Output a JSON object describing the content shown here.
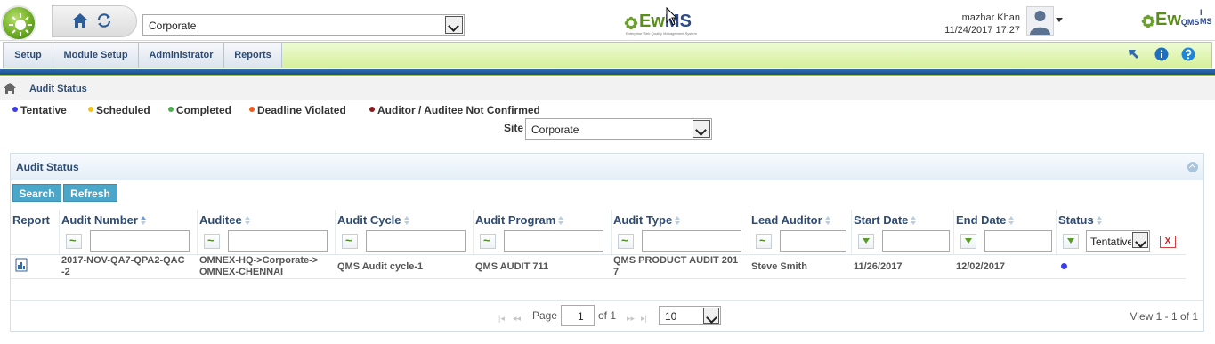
{
  "header": {
    "site_value": "Corporate",
    "center_logo_text": "Ew",
    "center_logo_ms": "MS",
    "center_logo_sub": "Enterprise Web Quality Management System",
    "right_logo_text": "Ew",
    "right_logo_q": "QMS",
    "right_logo_ims": "I MS",
    "user_name": "mazhar Khan",
    "datetime": "11/24/2017 17:27"
  },
  "menu": {
    "items": [
      {
        "label": "Setup"
      },
      {
        "label": "Module Setup"
      },
      {
        "label": "Administrator"
      },
      {
        "label": "Reports"
      }
    ]
  },
  "breadcrumb": {
    "title": "Audit Status"
  },
  "legend": {
    "items": [
      {
        "label": "Tentative",
        "color": "#3d3de8"
      },
      {
        "label": "Scheduled",
        "color": "#f3c21a"
      },
      {
        "label": "Completed",
        "color": "#4caf50"
      },
      {
        "label": "Deadline Violated",
        "color": "#f05a1a"
      },
      {
        "label": "Auditor / Auditee Not Confirmed",
        "color": "#8b1a1a"
      }
    ]
  },
  "site": {
    "label": "Site",
    "value": "Corporate"
  },
  "panel": {
    "title": "Audit Status",
    "search_label": "Search",
    "refresh_label": "Refresh",
    "columns": [
      "Report",
      "Audit Number",
      "Auditee",
      "Audit Cycle",
      "Audit Program",
      "Audit Type",
      "Lead Auditor",
      "Start Date",
      "End Date",
      "Status"
    ],
    "status_filter_value": "Tentative",
    "clear_label": "X",
    "rows": [
      {
        "audit_number_l1": "2017-NOV-QA7-QPA2-QAC",
        "audit_number_l2": "-2",
        "auditee_l1": "OMNEX-HQ->Corporate->",
        "auditee_l2": "OMNEX-CHENNAI",
        "audit_cycle": "QMS Audit cycle-1",
        "audit_program": "QMS AUDIT 711",
        "audit_type_l1": "QMS PRODUCT AUDIT 201",
        "audit_type_l2": "7",
        "lead_auditor": "Steve Smith",
        "start_date": "11/26/2017",
        "end_date": "12/02/2017",
        "status": "Tentative"
      }
    ]
  },
  "pager": {
    "page_label": "Page",
    "page_value": "1",
    "of_label": "of 1",
    "rows_per_page": "10",
    "view_label": "View 1 - 1 of 1"
  }
}
